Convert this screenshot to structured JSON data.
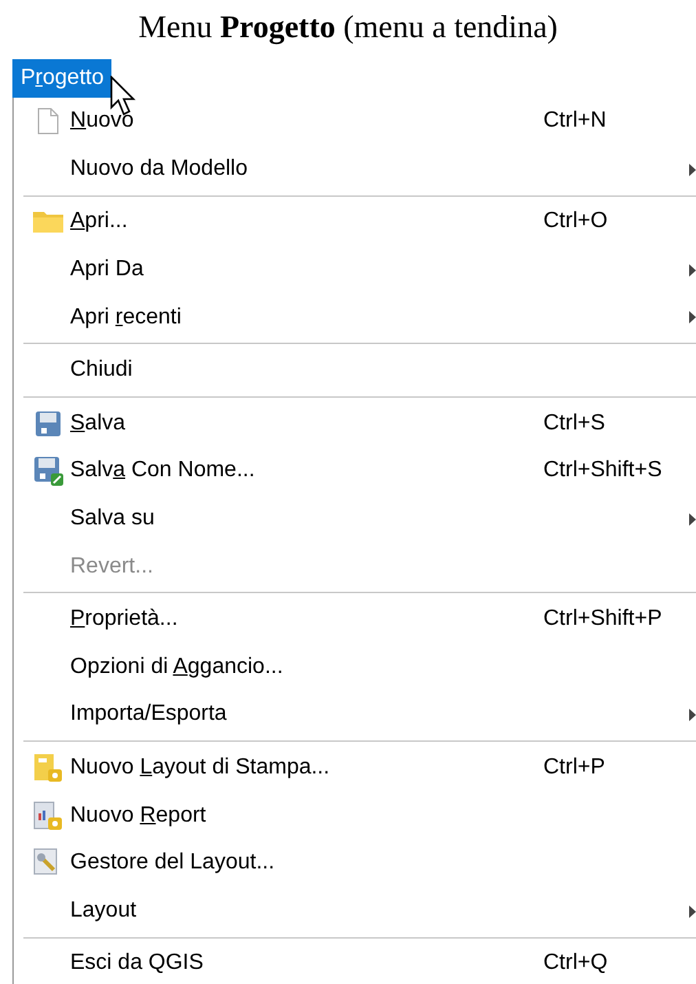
{
  "caption": "Menu **Progetto** (menu a tendina)",
  "menu_title": [
    {
      "text": "P",
      "underlined": false
    },
    {
      "text": "r",
      "underlined": true
    },
    {
      "text": "ogetto",
      "underlined": false
    }
  ],
  "groups": [
    [
      {
        "label": [
          {
            "text": "N",
            "underlined": true
          },
          {
            "text": "uovo",
            "underlined": false
          }
        ],
        "shortcut": "Ctrl+N",
        "submenu": false,
        "disabled": false
      },
      {
        "label": [
          {
            "text": "Nuovo da Modello",
            "underlined": false
          }
        ],
        "submenu": true,
        "disabled": false
      }
    ],
    [
      {
        "label": [
          {
            "text": "A",
            "underlined": true
          },
          {
            "text": "pri...",
            "underlined": false
          }
        ],
        "shortcut": "Ctrl+O",
        "submenu": false,
        "disabled": false
      },
      {
        "label": [
          {
            "text": "Apri Da",
            "underlined": false
          }
        ],
        "submenu": true,
        "disabled": false
      },
      {
        "label": [
          {
            "text": "Apri ",
            "underlined": false
          },
          {
            "text": "r",
            "underlined": true
          },
          {
            "text": "ecenti",
            "underlined": false
          }
        ],
        "submenu": true,
        "disabled": false
      }
    ],
    [
      {
        "label": [
          {
            "text": "Chiudi",
            "underlined": false
          }
        ],
        "submenu": false,
        "disabled": false
      }
    ],
    [
      {
        "label": [
          {
            "text": "S",
            "underlined": true
          },
          {
            "text": "alva",
            "underlined": false
          }
        ],
        "shortcut": "Ctrl+S",
        "submenu": false,
        "disabled": false
      },
      {
        "label": [
          {
            "text": "Salv",
            "underlined": false
          },
          {
            "text": "a",
            "underlined": true
          },
          {
            "text": " Con Nome...",
            "underlined": false
          }
        ],
        "shortcut": "Ctrl+Shift+S",
        "submenu": false,
        "disabled": false
      },
      {
        "label": [
          {
            "text": "Salva su",
            "underlined": false
          }
        ],
        "submenu": true,
        "disabled": false
      },
      {
        "label": [
          {
            "text": "Revert...",
            "underlined": false
          }
        ],
        "submenu": false,
        "disabled": true
      }
    ],
    [
      {
        "label": [
          {
            "text": "P",
            "underlined": true
          },
          {
            "text": "roprietà...",
            "underlined": false
          }
        ],
        "shortcut": "Ctrl+Shift+P",
        "submenu": false,
        "disabled": false
      },
      {
        "label": [
          {
            "text": "Opzioni di ",
            "underlined": false
          },
          {
            "text": "A",
            "underlined": true
          },
          {
            "text": "ggancio...",
            "underlined": false
          }
        ],
        "submenu": false,
        "disabled": false
      },
      {
        "label": [
          {
            "text": "Importa/Esporta",
            "underlined": false
          }
        ],
        "submenu": true,
        "disabled": false
      }
    ],
    [
      {
        "label": [
          {
            "text": "Nuovo ",
            "underlined": false
          },
          {
            "text": "L",
            "underlined": true
          },
          {
            "text": "ayout di Stampa...",
            "underlined": false
          }
        ],
        "shortcut": "Ctrl+P",
        "submenu": false,
        "disabled": false
      },
      {
        "label": [
          {
            "text": "Nuovo ",
            "underlined": false
          },
          {
            "text": "R",
            "underlined": true
          },
          {
            "text": "eport",
            "underlined": false
          }
        ],
        "submenu": false,
        "disabled": false
      },
      {
        "label": [
          {
            "text": "Gestore del Layout...",
            "underlined": false
          }
        ],
        "submenu": false,
        "disabled": false
      },
      {
        "label": [
          {
            "text": "Layout",
            "underlined": false
          }
        ],
        "submenu": true,
        "disabled": false
      }
    ],
    [
      {
        "label": [
          {
            "text": "Esci da QGIS",
            "underlined": false
          }
        ],
        "shortcut": "Ctrl+Q",
        "submenu": false,
        "disabled": false
      }
    ]
  ]
}
